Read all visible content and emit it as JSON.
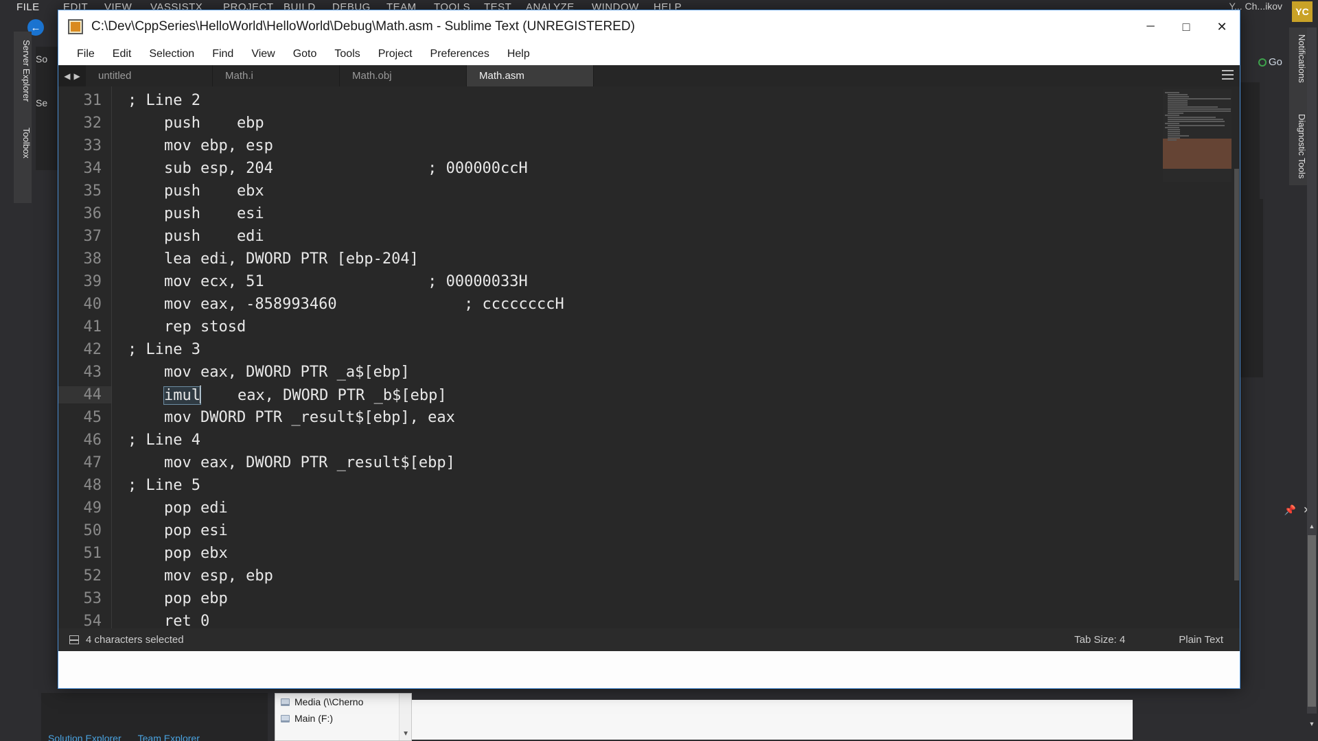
{
  "vs": {
    "menu_items": [
      "FILE",
      "EDIT",
      "VIEW",
      "VASSISTX",
      "PROJECT",
      "BUILD",
      "DEBUG",
      "TEAM",
      "TOOLS",
      "TEST",
      "ANALYZE",
      "WINDOW",
      "HELP"
    ],
    "user_name": "Y... Ch...ikov",
    "avatar_initials": "YC",
    "left_tabs": [
      "Server Explorer",
      "Toolbox"
    ],
    "right_tabs": [
      "Notifications",
      "Diagnostic Tools"
    ],
    "solution_label": "So",
    "search_label": "Se",
    "go_label": "Go",
    "bottom_tabs": [
      "Solution Explorer",
      "Team Explorer"
    ],
    "dropdown_items": [
      "Media (\\\\Cherno",
      "Main (F:)"
    ]
  },
  "sublime": {
    "title": "C:\\Dev\\CppSeries\\HelloWorld\\HelloWorld\\Debug\\Math.asm - Sublime Text (UNREGISTERED)",
    "title_icon": "sublime-logo-icon",
    "window_buttons": [
      {
        "name": "minimize",
        "glyph": "─"
      },
      {
        "name": "maximize",
        "glyph": "□"
      },
      {
        "name": "close",
        "glyph": "✕"
      }
    ],
    "menu": [
      "File",
      "Edit",
      "Selection",
      "Find",
      "View",
      "Goto",
      "Tools",
      "Project",
      "Preferences",
      "Help"
    ],
    "tabs": [
      {
        "label": "untitled",
        "active": false
      },
      {
        "label": "Math.i",
        "active": false
      },
      {
        "label": "Math.obj",
        "active": false
      },
      {
        "label": "Math.asm",
        "active": true
      }
    ],
    "code_lines": [
      {
        "num": "31",
        "text": "; Line 2"
      },
      {
        "num": "32",
        "text": "    push    ebp"
      },
      {
        "num": "33",
        "text": "    mov ebp, esp"
      },
      {
        "num": "34",
        "text": "    sub esp, 204                 ; 000000ccH"
      },
      {
        "num": "35",
        "text": "    push    ebx"
      },
      {
        "num": "36",
        "text": "    push    esi"
      },
      {
        "num": "37",
        "text": "    push    edi"
      },
      {
        "num": "38",
        "text": "    lea edi, DWORD PTR [ebp-204]"
      },
      {
        "num": "39",
        "text": "    mov ecx, 51                  ; 00000033H"
      },
      {
        "num": "40",
        "text": "    mov eax, -858993460              ; ccccccccH"
      },
      {
        "num": "41",
        "text": "    rep stosd"
      },
      {
        "num": "42",
        "text": "; Line 3"
      },
      {
        "num": "43",
        "text": "    mov eax, DWORD PTR _a$[ebp]"
      },
      {
        "num": "44",
        "text": "    imul    eax, DWORD PTR _b$[ebp]",
        "selected_token": "imul",
        "prefix": "    ",
        "suffix": "    eax, DWORD PTR _b$[ebp]",
        "current": true
      },
      {
        "num": "45",
        "text": "    mov DWORD PTR _result$[ebp], eax"
      },
      {
        "num": "46",
        "text": "; Line 4"
      },
      {
        "num": "47",
        "text": "    mov eax, DWORD PTR _result$[ebp]"
      },
      {
        "num": "48",
        "text": "; Line 5"
      },
      {
        "num": "49",
        "text": "    pop edi"
      },
      {
        "num": "50",
        "text": "    pop esi"
      },
      {
        "num": "51",
        "text": "    pop ebx"
      },
      {
        "num": "52",
        "text": "    mov esp, ebp"
      },
      {
        "num": "53",
        "text": "    pop ebp"
      },
      {
        "num": "54",
        "text": "    ret 0"
      }
    ],
    "status": {
      "selection": "4 characters selected",
      "tab_size": "Tab Size: 4",
      "syntax": "Plain Text"
    }
  }
}
